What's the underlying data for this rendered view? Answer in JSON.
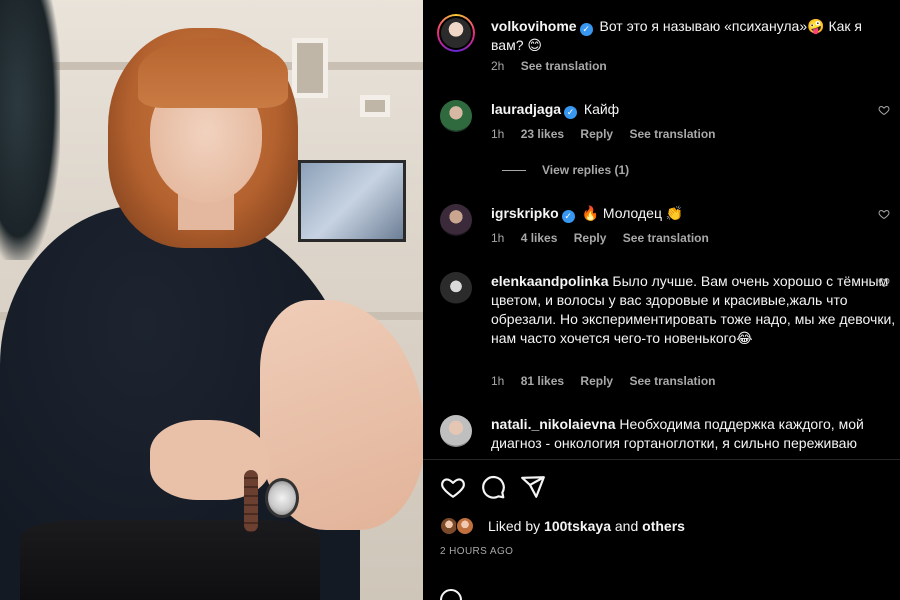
{
  "post": {
    "caption": {
      "username": "volkovihome",
      "verified": true,
      "text": "Вот это я называю «психанула»🤪 Как я вам? 😊",
      "time": "2h",
      "see_translation": "See translation"
    }
  },
  "comments": [
    {
      "username": "lauradjaga",
      "verified": true,
      "text": "Кайф",
      "time": "1h",
      "likes": "23 likes",
      "reply": "Reply",
      "see_translation": "See translation",
      "view_replies": "View replies (1)"
    },
    {
      "username": "igrskripko",
      "verified": true,
      "text": "🔥 Молодец 👏",
      "time": "1h",
      "likes": "4 likes",
      "reply": "Reply",
      "see_translation": "See translation"
    },
    {
      "username": "elenkaandpolinka",
      "verified": false,
      "text": "Было лучше. Вам очень хорошо с тёмным цветом, и волосы у вас здоровые и красивые,жаль что обрезали. Но экспериментировать тоже надо, мы же девочки, нам часто хочется чего-то новенького😂",
      "time": "1h",
      "likes": "81 likes",
      "reply": "Reply",
      "see_translation": "See translation"
    },
    {
      "username": "natali._nikolaievna",
      "verified": false,
      "text": "Необходима поддержка каждого, мой диагноз - онкология гортаноглотки, я сильно переживаю"
    }
  ],
  "actions": {
    "like_icon": "heart-outline-icon",
    "comment_icon": "comment-bubble-icon",
    "share_icon": "paper-plane-icon"
  },
  "likes_summary": {
    "prefix": "Liked by",
    "user": "100tskaya",
    "connector": "and",
    "others": "others"
  },
  "posted_ago": "2 HOURS AGO",
  "colors": {
    "background": "#000000",
    "text": "#f5f5f5",
    "secondary_text": "#a8a8a8",
    "verified": "#3897f0",
    "divider": "#262626"
  }
}
